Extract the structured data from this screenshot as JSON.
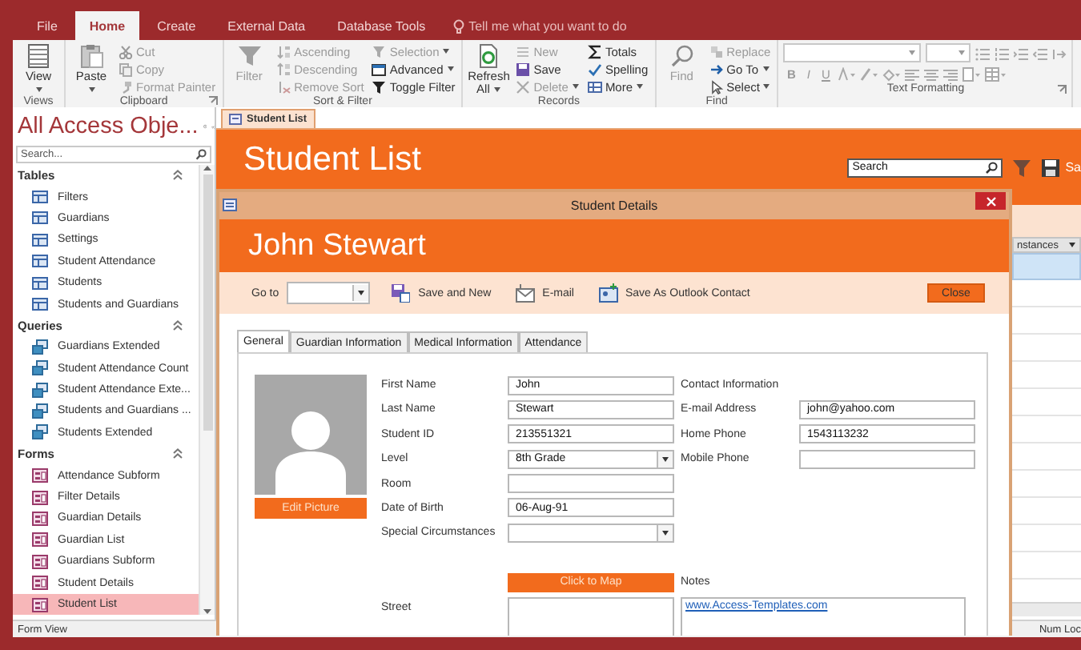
{
  "ribbon": {
    "tabs": [
      {
        "label": "File",
        "selected": false
      },
      {
        "label": "Home",
        "selected": true
      },
      {
        "label": "Create",
        "selected": false
      },
      {
        "label": "External Data",
        "selected": false
      },
      {
        "label": "Database Tools",
        "selected": false
      }
    ],
    "tell_me": "Tell me what you want to do",
    "groups": [
      {
        "label": "Views",
        "launcher": false,
        "commands": [
          {
            "kind": "large",
            "label": "View",
            "dropdown": true,
            "disabled": false
          }
        ]
      },
      {
        "label": "Clipboard",
        "launcher": true,
        "commands": [
          {
            "kind": "large",
            "label": "Paste",
            "dropdown": true,
            "disabled": false
          },
          {
            "kind": "small",
            "label": "Cut",
            "dropdown": false,
            "disabled": true
          },
          {
            "kind": "small",
            "label": "Copy",
            "dropdown": false,
            "disabled": true
          },
          {
            "kind": "small",
            "label": "Format Painter",
            "dropdown": false,
            "disabled": true
          }
        ]
      },
      {
        "label": "Sort & Filter",
        "launcher": false,
        "commands": [
          {
            "kind": "large",
            "label": "Filter",
            "dropdown": false,
            "disabled": true
          },
          {
            "kind": "small",
            "label": "Ascending",
            "dropdown": false,
            "disabled": true
          },
          {
            "kind": "small",
            "label": "Descending",
            "dropdown": false,
            "disabled": true
          },
          {
            "kind": "small",
            "label": "Remove Sort",
            "dropdown": false,
            "disabled": true
          },
          {
            "kind": "small",
            "label": "Selection",
            "dropdown": true,
            "disabled": true
          },
          {
            "kind": "small",
            "label": "Advanced",
            "dropdown": true,
            "disabled": false
          },
          {
            "kind": "small",
            "label": "Toggle Filter",
            "dropdown": false,
            "disabled": false
          }
        ]
      },
      {
        "label": "Records",
        "launcher": false,
        "commands": [
          {
            "kind": "large",
            "label": "Refresh All",
            "dropdown": true,
            "disabled": false
          },
          {
            "kind": "small",
            "label": "New",
            "dropdown": false,
            "disabled": true
          },
          {
            "kind": "small",
            "label": "Save",
            "dropdown": false,
            "disabled": false
          },
          {
            "kind": "small",
            "label": "Delete",
            "dropdown": true,
            "disabled": true
          },
          {
            "kind": "small",
            "label": "Totals",
            "dropdown": false,
            "disabled": false
          },
          {
            "kind": "small",
            "label": "Spelling",
            "dropdown": false,
            "disabled": false
          },
          {
            "kind": "small",
            "label": "More",
            "dropdown": true,
            "disabled": false
          }
        ]
      },
      {
        "label": "Find",
        "launcher": false,
        "commands": [
          {
            "kind": "large",
            "label": "Find",
            "dropdown": false,
            "disabled": true
          },
          {
            "kind": "small",
            "label": "Replace",
            "dropdown": false,
            "disabled": true
          },
          {
            "kind": "small",
            "label": "Go To",
            "dropdown": true,
            "disabled": false
          },
          {
            "kind": "small",
            "label": "Select",
            "dropdown": true,
            "disabled": false
          }
        ]
      },
      {
        "label": "Text Formatting",
        "launcher": true,
        "format_buttons": [
          "B",
          "I",
          "U"
        ]
      }
    ]
  },
  "navigation": {
    "title": "All Access Obje...",
    "search": {
      "placeholder": "Search..."
    },
    "groups": [
      {
        "label": "Tables",
        "kind": "table",
        "items": [
          {
            "label": "Filters",
            "selected": false
          },
          {
            "label": "Guardians",
            "selected": false
          },
          {
            "label": "Settings",
            "selected": false
          },
          {
            "label": "Student Attendance",
            "selected": false
          },
          {
            "label": "Students",
            "selected": false
          },
          {
            "label": "Students and Guardians",
            "selected": false
          }
        ]
      },
      {
        "label": "Queries",
        "kind": "query",
        "items": [
          {
            "label": "Guardians Extended",
            "selected": false
          },
          {
            "label": "Student Attendance Count",
            "selected": false
          },
          {
            "label": "Student Attendance Exte...",
            "selected": false
          },
          {
            "label": "Students and Guardians ...",
            "selected": false
          },
          {
            "label": "Students Extended",
            "selected": false
          }
        ]
      },
      {
        "label": "Forms",
        "kind": "form",
        "items": [
          {
            "label": "Attendance Subform",
            "selected": false
          },
          {
            "label": "Filter Details",
            "selected": false
          },
          {
            "label": "Guardian Details",
            "selected": false
          },
          {
            "label": "Guardian List",
            "selected": false
          },
          {
            "label": "Guardians Subform",
            "selected": false
          },
          {
            "label": "Student Details",
            "selected": false
          },
          {
            "label": "Student List",
            "selected": true
          }
        ]
      }
    ]
  },
  "document_tabs": [
    {
      "label": "Student List",
      "selected": true
    }
  ],
  "form": {
    "title": "Student List",
    "search": {
      "value": "Search"
    },
    "save_label": "Sa",
    "datasheet": {
      "columns": [
        "nstances"
      ],
      "rows": [
        {
          "selected": true
        },
        {
          "selected": false
        },
        {
          "selected": false
        },
        {
          "selected": false
        },
        {
          "selected": false
        },
        {
          "selected": false
        },
        {
          "selected": false
        },
        {
          "selected": false
        },
        {
          "selected": false
        },
        {
          "selected": false
        },
        {
          "selected": false
        },
        {
          "selected": false
        }
      ]
    }
  },
  "dialog": {
    "title": "Student Details",
    "heading": "John Stewart",
    "toolbar": {
      "goto_label": "Go to",
      "actions": [
        "Save and New",
        "E-mail",
        "Save As Outlook Contact"
      ],
      "close": "Close"
    },
    "tabs": [
      {
        "label": "General",
        "selected": true
      },
      {
        "label": "Guardian Information",
        "selected": false
      },
      {
        "label": "Medical Information",
        "selected": false
      },
      {
        "label": "Attendance",
        "selected": false
      }
    ],
    "edit_picture": "Edit Picture",
    "fields": [
      {
        "label": "First Name",
        "value": "John",
        "kind": "text"
      },
      {
        "label": "Last Name",
        "value": "Stewart",
        "kind": "text"
      },
      {
        "label": "Student ID",
        "value": "213551321",
        "kind": "text"
      },
      {
        "label": "Level",
        "value": "8th Grade",
        "kind": "combo"
      },
      {
        "label": "Room",
        "kind": "text"
      },
      {
        "label": "Date of Birth",
        "value": "06-Aug-91",
        "kind": "text"
      },
      {
        "label": "Special Circumstances",
        "kind": "combo"
      }
    ],
    "contact": {
      "heading": "Contact Information",
      "fields": [
        {
          "label": "E-mail Address",
          "value": "john@yahoo.com",
          "kind": "text"
        },
        {
          "label": "Home Phone",
          "value": "1543113232",
          "kind": "text"
        },
        {
          "label": "Mobile Phone",
          "kind": "text"
        }
      ]
    },
    "map_button": "Click to Map",
    "notes": {
      "label": "Notes",
      "link": "www.Access-Templates.com"
    },
    "street": {
      "label": "Street"
    }
  },
  "status_bar": {
    "left": "Form View",
    "right": "Num Loc"
  }
}
